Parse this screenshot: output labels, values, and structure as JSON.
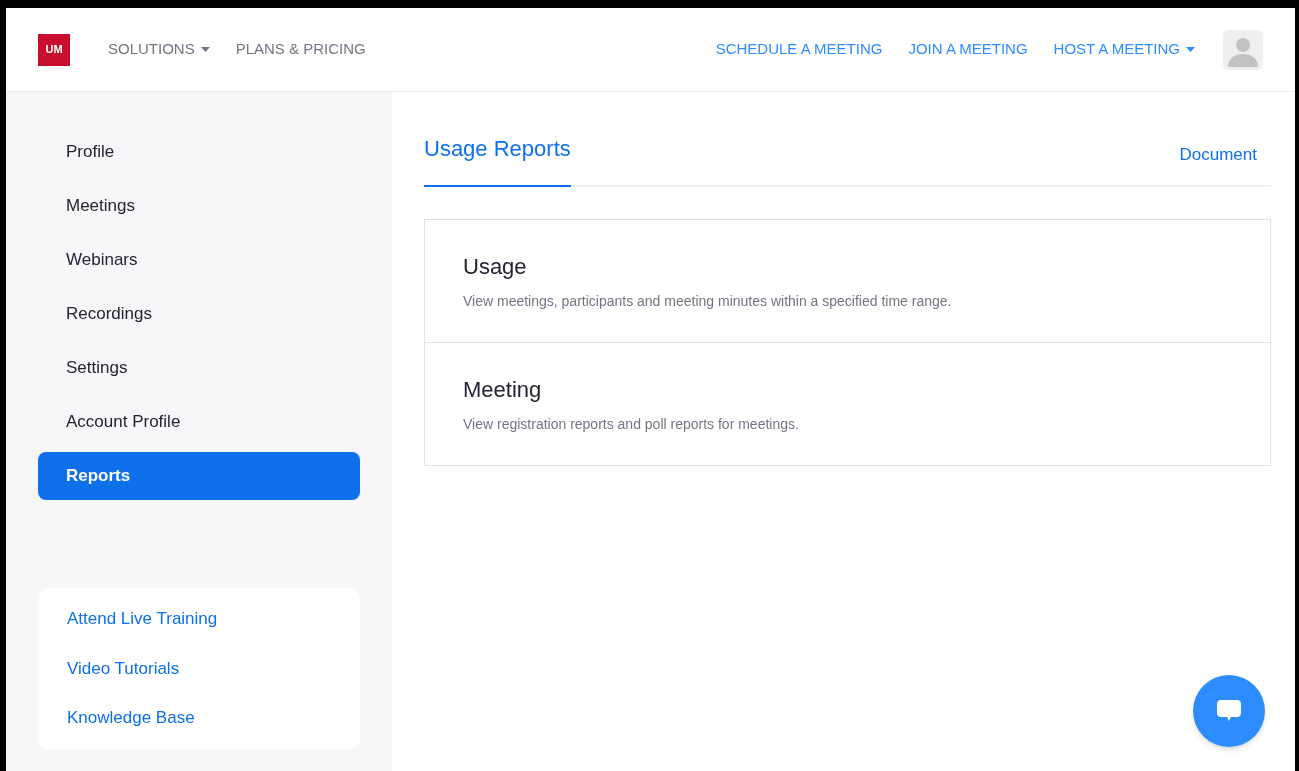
{
  "logo": "UM",
  "nav_left": [
    {
      "label": "SOLUTIONS",
      "dropdown": true
    },
    {
      "label": "PLANS & PRICING",
      "dropdown": false
    }
  ],
  "nav_right": [
    {
      "label": "SCHEDULE A MEETING",
      "dropdown": false
    },
    {
      "label": "JOIN A MEETING",
      "dropdown": false
    },
    {
      "label": "HOST A MEETING",
      "dropdown": true
    }
  ],
  "sidebar": {
    "items": [
      {
        "label": "Profile",
        "selected": false
      },
      {
        "label": "Meetings",
        "selected": false
      },
      {
        "label": "Webinars",
        "selected": false
      },
      {
        "label": "Recordings",
        "selected": false
      },
      {
        "label": "Settings",
        "selected": false
      },
      {
        "label": "Account Profile",
        "selected": false
      },
      {
        "label": "Reports",
        "selected": true
      }
    ],
    "help_links": [
      "Attend Live Training",
      "Video Tutorials",
      "Knowledge Base"
    ]
  },
  "tabs": [
    {
      "label": "Usage Reports",
      "selected": true
    }
  ],
  "document_link": "Document",
  "reports": [
    {
      "title": "Usage",
      "description": "View meetings, participants and meeting minutes within a specified time range."
    },
    {
      "title": "Meeting",
      "description": "View registration reports and poll reports for meetings."
    }
  ]
}
